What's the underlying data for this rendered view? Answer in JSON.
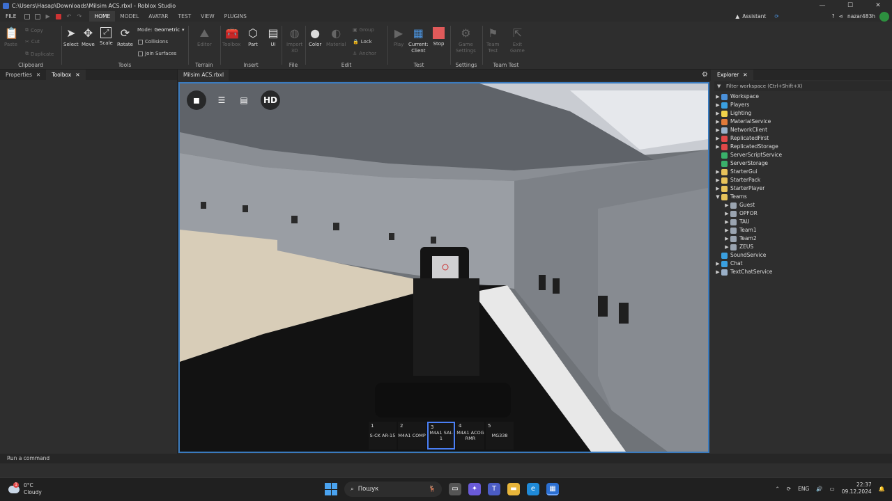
{
  "window": {
    "title": "C:\\Users\\Hasap\\Downloads\\Milsim ACS.rbxl - Roblox Studio"
  },
  "menu": {
    "file": "FILE",
    "tabs": [
      "HOME",
      "MODEL",
      "AVATAR",
      "TEST",
      "VIEW",
      "PLUGINS"
    ],
    "active_tab": "HOME"
  },
  "topbar": {
    "assistant": "Assistant",
    "username": "nazar483h"
  },
  "ribbon": {
    "clipboard": {
      "label": "Clipboard",
      "paste": "Paste",
      "copy": "Copy",
      "cut": "Cut",
      "duplicate": "Duplicate"
    },
    "tools": {
      "label": "Tools",
      "select": "Select",
      "move": "Move",
      "scale": "Scale",
      "rotate": "Rotate",
      "mode_label": "Mode:",
      "mode_value": "Geometric",
      "collisions": "Collisions",
      "join_surfaces": "Join Surfaces"
    },
    "terrain": {
      "label": "Terrain",
      "editor": "Editor"
    },
    "insert": {
      "label": "Insert",
      "toolbox": "Toolbox",
      "part": "Part",
      "ui": "UI"
    },
    "file": {
      "label": "File",
      "import3d_1": "Import",
      "import3d_2": "3D"
    },
    "edit": {
      "label": "Edit",
      "color": "Color",
      "material": "Material",
      "group": "Group",
      "lock": "Lock",
      "anchor": "Anchor"
    },
    "test": {
      "label": "Test",
      "play": "Play",
      "current1": "Current:",
      "current2": "Client",
      "stop": "Stop"
    },
    "settings": {
      "label": "Settings",
      "game1": "Game",
      "game2": "Settings"
    },
    "teamtest": {
      "label": "Team Test",
      "team1": "Team",
      "team2": "Test",
      "exit1": "Exit",
      "exit2": "Game"
    }
  },
  "left_panel": {
    "tabs": [
      "Properties",
      "Toolbox"
    ],
    "active": "Toolbox"
  },
  "document_tab": "Milsim ACS.rbxl",
  "viewport": {
    "hd_label": "HD",
    "hotbar": [
      {
        "num": "1",
        "name": "S-CK AR-15"
      },
      {
        "num": "2",
        "name": "M4A1 COMP"
      },
      {
        "num": "3",
        "name": "M4A1 SAI-1"
      },
      {
        "num": "4",
        "name": "M4A1 ACOG RMR"
      },
      {
        "num": "5",
        "name": "MG338"
      }
    ],
    "selected_slot": 3
  },
  "explorer": {
    "title": "Explorer",
    "filter_placeholder": "Filter workspace (Ctrl+Shift+X)",
    "items": [
      {
        "label": "Workspace",
        "icon": "globe-icon",
        "color": "#4a90d9",
        "indent": 0,
        "arrow": "▶"
      },
      {
        "label": "Players",
        "icon": "players-icon",
        "color": "#3aa0e0",
        "indent": 0,
        "arrow": "▶"
      },
      {
        "label": "Lighting",
        "icon": "lightbulb-icon",
        "color": "#f0d24a",
        "indent": 0,
        "arrow": "▶"
      },
      {
        "label": "MaterialService",
        "icon": "material-icon",
        "color": "#e07a3a",
        "indent": 0,
        "arrow": "▶"
      },
      {
        "label": "NetworkClient",
        "icon": "network-icon",
        "color": "#9ab0c8",
        "indent": 0,
        "arrow": "▶"
      },
      {
        "label": "ReplicatedFirst",
        "icon": "replicated-first-icon",
        "color": "#e04848",
        "indent": 0,
        "arrow": "▶"
      },
      {
        "label": "ReplicatedStorage",
        "icon": "replicated-storage-icon",
        "color": "#e04848",
        "indent": 0,
        "arrow": "▶"
      },
      {
        "label": "ServerScriptService",
        "icon": "server-script-icon",
        "color": "#3ab06a",
        "indent": 0,
        "arrow": ""
      },
      {
        "label": "ServerStorage",
        "icon": "server-storage-icon",
        "color": "#3ab06a",
        "indent": 0,
        "arrow": ""
      },
      {
        "label": "StarterGui",
        "icon": "folder-icon",
        "color": "#e8c35a",
        "indent": 0,
        "arrow": "▶"
      },
      {
        "label": "StarterPack",
        "icon": "folder-icon",
        "color": "#e8c35a",
        "indent": 0,
        "arrow": "▶"
      },
      {
        "label": "StarterPlayer",
        "icon": "folder-icon",
        "color": "#e8c35a",
        "indent": 0,
        "arrow": "▶"
      },
      {
        "label": "Teams",
        "icon": "folder-icon",
        "color": "#e8c35a",
        "indent": 0,
        "arrow": "▼"
      },
      {
        "label": "Guest",
        "icon": "team-icon",
        "color": "#9aa4b0",
        "indent": 1,
        "arrow": "▶"
      },
      {
        "label": "OPFOR",
        "icon": "team-icon",
        "color": "#9aa4b0",
        "indent": 1,
        "arrow": "▶"
      },
      {
        "label": "TAU",
        "icon": "team-icon",
        "color": "#9aa4b0",
        "indent": 1,
        "arrow": "▶"
      },
      {
        "label": "Team1",
        "icon": "team-icon",
        "color": "#9aa4b0",
        "indent": 1,
        "arrow": "▶"
      },
      {
        "label": "Team2",
        "icon": "team-icon",
        "color": "#9aa4b0",
        "indent": 1,
        "arrow": "▶"
      },
      {
        "label": "ZEUS",
        "icon": "team-icon",
        "color": "#9aa4b0",
        "indent": 1,
        "arrow": "▶"
      },
      {
        "label": "SoundService",
        "icon": "sound-icon",
        "color": "#3aa0e0",
        "indent": 0,
        "arrow": ""
      },
      {
        "label": "Chat",
        "icon": "chat-icon",
        "color": "#3aa0e0",
        "indent": 0,
        "arrow": "▶"
      },
      {
        "label": "TextChatService",
        "icon": "text-chat-icon",
        "color": "#9ab0c8",
        "indent": 0,
        "arrow": "▶"
      }
    ]
  },
  "command_bar": {
    "placeholder": "Run a command"
  },
  "taskbar": {
    "weather_temp": "0°C",
    "weather_desc": "Cloudy",
    "weather_badge": "1",
    "search_placeholder": "Пошук",
    "lang": "ENG",
    "time": "22:37",
    "date": "09.12.2024"
  }
}
